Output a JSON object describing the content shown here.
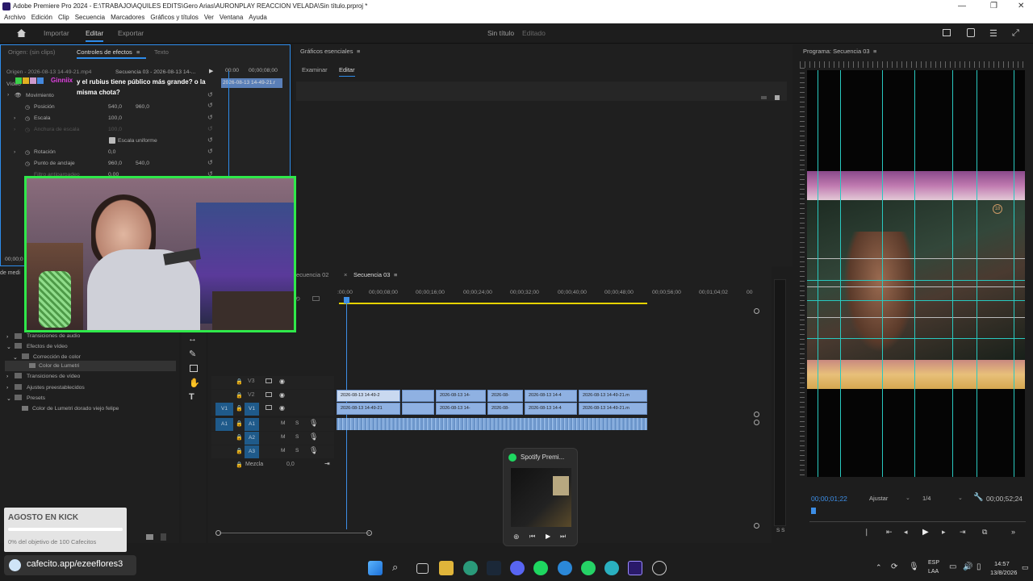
{
  "titlebar": {
    "title": "Adobe Premiere Pro 2024 - E:\\TRABAJO\\AQUILES EDITS\\Gero Arias\\AURONPLAY REACCION VELADA\\Sin título.prproj *",
    "minimize": "—",
    "maximize": "❐",
    "close": "✕"
  },
  "menu": [
    "Archivo",
    "Edición",
    "Clip",
    "Secuencia",
    "Marcadores",
    "Gráficos y títulos",
    "Ver",
    "Ventana",
    "Ayuda"
  ],
  "workspace": {
    "tabs": [
      "Importar",
      "Editar",
      "Exportar"
    ],
    "project": "Sin título",
    "status": "Editado"
  },
  "effects_panel": {
    "tabs": [
      "Origen: (sin clips)",
      "Controles de efectos",
      "Texto"
    ],
    "clip": "Origen - 2026-08-13 14-49-21.mp4",
    "sequence": "Secuencia 03 - 2026-08-13 14-...",
    "timecode_start": "00:00",
    "timecode_end": "00;00;08;00",
    "clip_bar": "2026-08-13 14-49-21.r",
    "section": "Vídeo",
    "movimiento": "Movimiento",
    "props": [
      {
        "name": "Posición",
        "v1": "540,0",
        "v2": "960,0"
      },
      {
        "name": "Escala",
        "v1": "100,0",
        "v2": ""
      },
      {
        "name": "Anchura de escala",
        "v1": "100,0",
        "v2": ""
      },
      {
        "name": "Escala uniforme",
        "v1": "",
        "v2": ""
      },
      {
        "name": "Rotación",
        "v1": "0,0",
        "v2": ""
      },
      {
        "name": "Punto de anclaje",
        "v1": "960,0",
        "v2": "540,0"
      },
      {
        "name": "Filtro antiparpadeo",
        "v1": "0,00",
        "v2": ""
      }
    ],
    "timecode": "00;00;0"
  },
  "chat": {
    "user": "Ginniix",
    "message": "y el rubius tiene público más grande? o la misma chota?"
  },
  "graphics": {
    "title": "Gráficos esenciales",
    "tabs": [
      "Examinar",
      "Editar"
    ]
  },
  "program": {
    "title": "Programa: Secuencia 03",
    "timecode": "00;00;01;22",
    "fit": "Ajustar",
    "quality": "1/4",
    "duration": "00;00;52;24",
    "badge": "18"
  },
  "timeline": {
    "tabs": [
      "Secuencia 02",
      "Secuencia 03"
    ],
    "ruler": [
      ":00;00",
      "00;00;08;00",
      "00;00;16;00",
      "00;00;24;00",
      "00;00;32;00",
      "00;00;40;00",
      "00;00;48;00",
      "00;00;56;00",
      "00;01;04;02",
      "00"
    ],
    "tracks_v": [
      "V3",
      "V2",
      "V1"
    ],
    "tracks_a": [
      "A1",
      "A2",
      "A3"
    ],
    "mix": "Mezcla",
    "mix_val": "0,0",
    "src_v": "V1",
    "src_a": "A1",
    "clips_v2": [
      "2026-08-13 14-49-2",
      "",
      "2026-08-13 14-",
      "2026-08-",
      "2026-08-13 14-4",
      "2026-08-13 14-49-21.m"
    ],
    "clips_v1": [
      "2026-08-13 14-49-21",
      "",
      "2026-08-13 14-",
      "2026-08-",
      "2026-08-13 14-4",
      "2026-08-13 14-49-21.m"
    ]
  },
  "project_panel": {
    "head": "de medi",
    "items": [
      "Transiciones de audio",
      "Efectos de vídeo",
      "Corrección de color",
      "Color de Lumetri",
      "Transiciones de vídeo",
      "Ajustes preestablecidos",
      "Presets",
      "Color de Lumetri dorado viejo felipe"
    ]
  },
  "overlay": {
    "kick_title": "AGOSTO EN KICK",
    "kick_sub": "0% del objetivo de 100 Cafecitos",
    "cafecito": "cafecito.app/ezeeflores3"
  },
  "spotify": {
    "title": "Spotify Premi..."
  },
  "taskbar": {
    "lang1": "ESP",
    "lang2": "LAA",
    "time": "14:57",
    "date": "13/8/2026"
  }
}
